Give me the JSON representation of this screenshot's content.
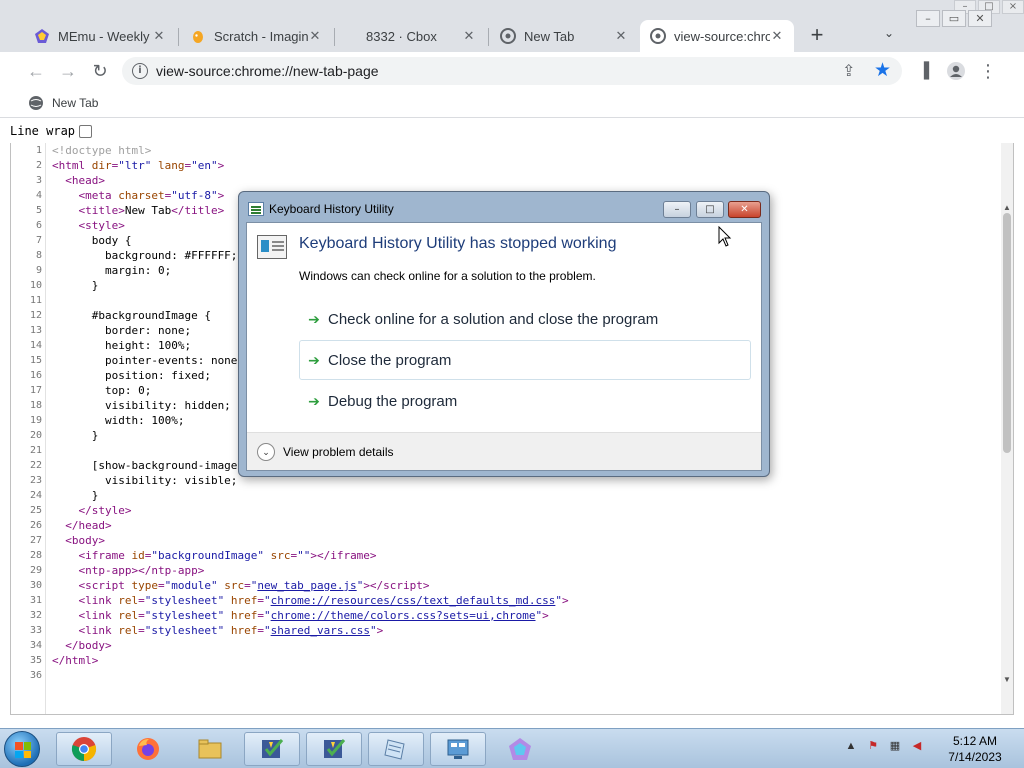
{
  "browser": {
    "tabs": [
      {
        "title": "MEmu - Weekly",
        "icon": "memu-icon"
      },
      {
        "title": "Scratch - Imagine",
        "icon": "scratch-icon"
      },
      {
        "title": "8332 · Cbox",
        "icon": "none"
      },
      {
        "title": "New Tab",
        "icon": "chrome-icon"
      },
      {
        "title": "view-source:chrome",
        "icon": "chrome-icon"
      }
    ],
    "address": "view-source:chrome://new-tab-page",
    "bookmark": "New Tab"
  },
  "source_view": {
    "line_wrap_label": "Line wrap",
    "line_count": 36
  },
  "dialog": {
    "title": "Keyboard History Utility",
    "heading": "Keyboard History Utility has stopped working",
    "subtitle": "Windows can check online for a solution to the problem.",
    "options": [
      "Check online for a solution and close the program",
      "Close the program",
      "Debug the program"
    ],
    "details": "View problem details"
  },
  "taskbar": {
    "time": "5:12 AM",
    "date": "7/14/2023"
  },
  "colors": {
    "tag": "#881280",
    "attribute": "#994500",
    "value": "#1a1aa6",
    "doctype": "#a0a0a0",
    "accent": "#1a73e8"
  }
}
